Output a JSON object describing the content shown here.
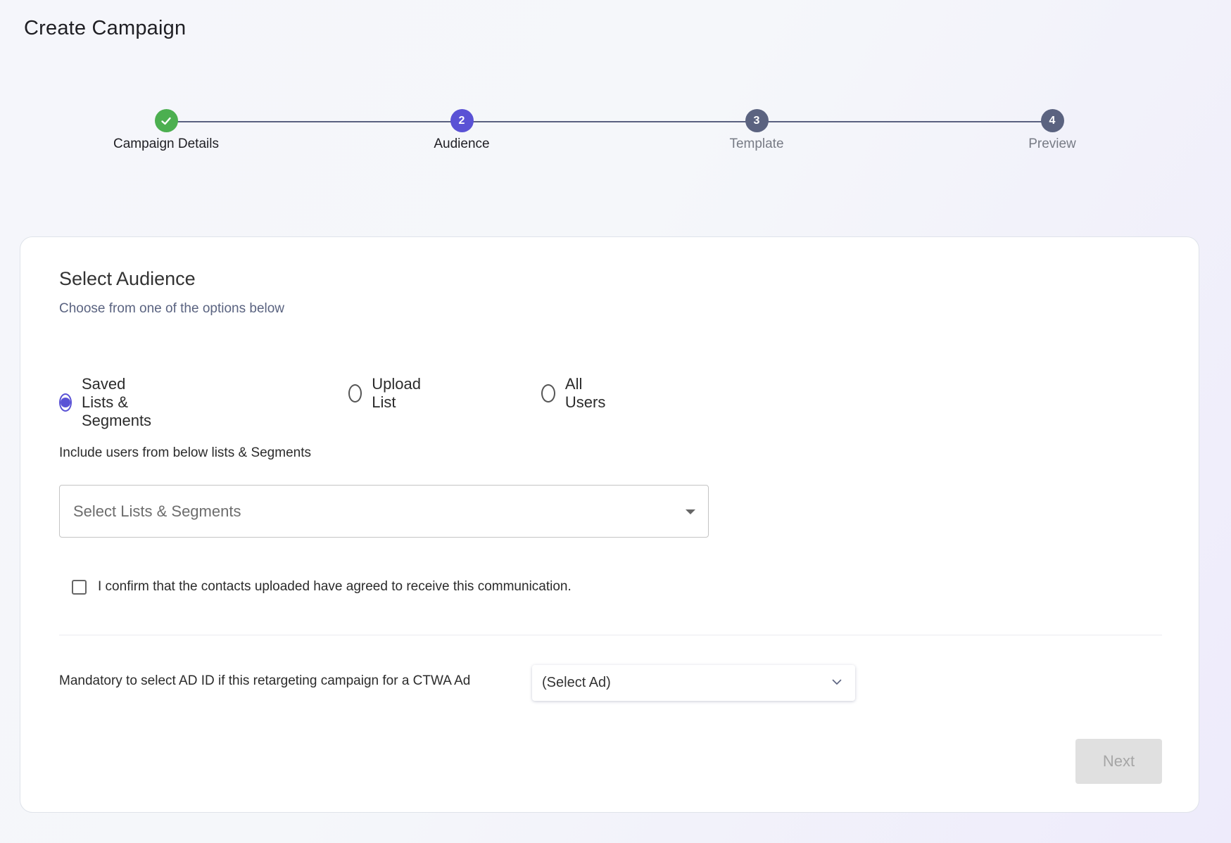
{
  "page": {
    "title": "Create Campaign"
  },
  "stepper": {
    "steps": [
      {
        "number": "1",
        "label": "Campaign Details",
        "state": "done",
        "icon": "check-icon"
      },
      {
        "number": "2",
        "label": "Audience",
        "state": "active"
      },
      {
        "number": "3",
        "label": "Template",
        "state": "pending"
      },
      {
        "number": "4",
        "label": "Preview",
        "state": "pending"
      }
    ]
  },
  "audience": {
    "title": "Select Audience",
    "subtitle": "Choose from one of the options below",
    "options": [
      {
        "label": "Saved Lists & Segments",
        "checked": true
      },
      {
        "label": "Upload List",
        "checked": false
      },
      {
        "label": "All Users",
        "checked": false
      }
    ],
    "include_label": "Include users from below lists & Segments",
    "list_select": {
      "placeholder": "Select Lists & Segments",
      "value": ""
    },
    "confirm": {
      "label": "I confirm that the contacts uploaded have agreed to receive this communication.",
      "checked": false
    },
    "ad_label": "Mandatory to select AD ID if this retargeting campaign for a CTWA Ad",
    "ad_select": {
      "value": "(Select Ad)"
    },
    "next_label": "Next",
    "next_disabled": true
  },
  "colors": {
    "accent": "#5a52d5",
    "success": "#4caf50",
    "pending": "#5b6380",
    "disabled_button_bg": "#e0e0e0",
    "disabled_button_text": "#a6a6a6"
  }
}
